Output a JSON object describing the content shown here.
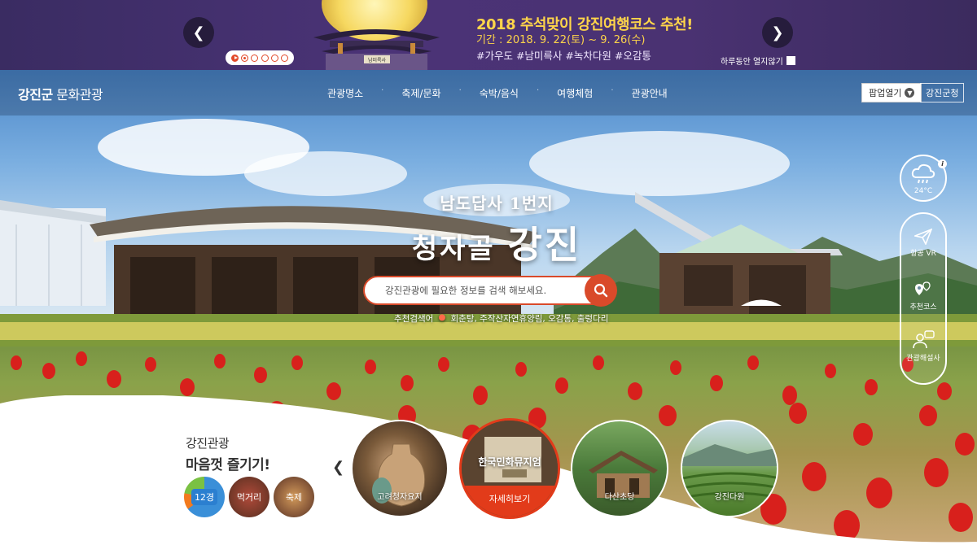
{
  "promo": {
    "title": "2018 추석맞이 강진여행코스 추천!",
    "period": "기간 : 2018. 9. 22(토) ~ 9. 26(수)",
    "tags": "#가우도 #남미륵사 #녹차다원 #오감통",
    "sign": "남미륵사",
    "prev_icon": "chevron-left-icon",
    "next_icon": "chevron-right-icon",
    "no_show_label": "하루동안 열지않기"
  },
  "nav": {
    "brand_bold": "강진군",
    "brand_rest": " 문화관광",
    "menu": [
      "관광명소",
      "축제/문화",
      "숙박/음식",
      "여행체험",
      "관광안내"
    ],
    "popup_button": "팝업열기",
    "gov_button": "강진군청"
  },
  "hero": {
    "tagline_1": "남도답사 1번지",
    "tagline_2": "청자골",
    "tagline_3": "강진",
    "search_placeholder": "강진관광에 필요한 정보를 검색 해보세요.",
    "recommend_label": "추천검색어",
    "recommend_terms": "회춘탕, 주작산자연휴양림, 오감통, 출렁다리"
  },
  "weather": {
    "temp": "24°C",
    "icon": "rain-cloud-icon",
    "info": "i"
  },
  "sidebar": {
    "items": [
      {
        "label": "항공 VR",
        "icon": "paper-plane-icon"
      },
      {
        "label": "추천코스",
        "icon": "route-pin-icon"
      },
      {
        "label": "관광해설사",
        "icon": "guide-chat-icon"
      }
    ]
  },
  "bottom": {
    "enjoy_1": "강진관광",
    "enjoy_2": "마음껏 즐기기!",
    "small": [
      "12경",
      "먹거리",
      "축제"
    ],
    "cards": [
      "고려청자요지",
      "다산초당",
      "강진다원"
    ],
    "featured_name": "한국민화뮤지엄",
    "featured_detail": "자세히보기"
  },
  "colors": {
    "promo_bg": "#4b3377",
    "promo_text": "#ffd54a",
    "accent": "#d94a2a",
    "nav_text": "#ffffff"
  }
}
